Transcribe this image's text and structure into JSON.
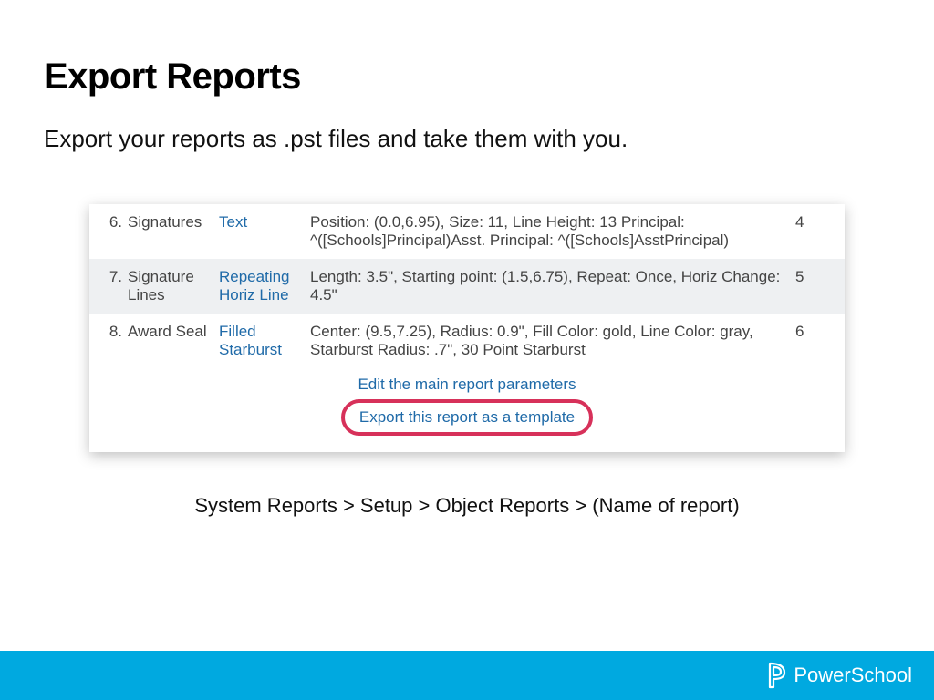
{
  "title": "Export Reports",
  "subtitle": "Export your reports as .pst files and take them with you.",
  "rows": [
    {
      "num": "6.",
      "name": "Signatures",
      "type": "Text",
      "desc": "Position: (0.0,6.95), Size: 11, Line Height: 13 Principal: ^([Schools]Principal)Asst. Principal: ^([Schools]AsstPrincipal)",
      "right": "4"
    },
    {
      "num": "7.",
      "name": "Signature Lines",
      "type": "Repeating Horiz Line",
      "desc": "Length: 3.5\", Starting point: (1.5,6.75), Repeat: Once, Horiz Change: 4.5\"",
      "right": "5"
    },
    {
      "num": "8.",
      "name": "Award Seal",
      "type": "Filled Starburst",
      "desc": "Center: (9.5,7.25), Radius: 0.9\", Fill Color: gold, Line Color: gray, Starburst Radius: .7\", 30 Point Starburst",
      "right": "6"
    }
  ],
  "actions": {
    "edit": "Edit the main report parameters",
    "export": "Export this report as a template"
  },
  "breadcrumb": "System Reports > Setup > Object Reports > (Name of report)",
  "brand": "PowerSchool"
}
